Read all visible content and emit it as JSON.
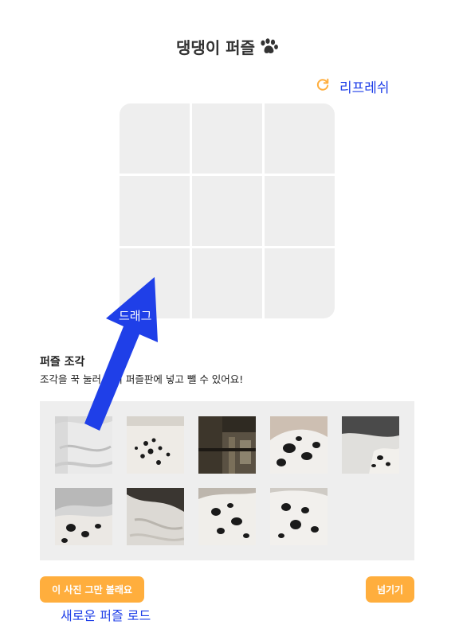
{
  "header": {
    "title": "댕댕이 퍼즐",
    "icon": "paw-icon"
  },
  "refresh": {
    "label": "리프레쉬",
    "icon": "refresh-icon",
    "color": "#ffae3d"
  },
  "board": {
    "rows": 3,
    "cols": 3,
    "cell_color": "#eeeeee"
  },
  "pieces_section": {
    "title": "퍼즐 조각",
    "description": "조각을 꾹 눌러서 위 퍼즐판에 넣고 뺄 수 있어요!",
    "pieces": [
      {
        "name": "puzzle-piece-1"
      },
      {
        "name": "puzzle-piece-2"
      },
      {
        "name": "puzzle-piece-3"
      },
      {
        "name": "puzzle-piece-4"
      },
      {
        "name": "puzzle-piece-5"
      },
      {
        "name": "puzzle-piece-6"
      },
      {
        "name": "puzzle-piece-7"
      },
      {
        "name": "puzzle-piece-8"
      },
      {
        "name": "puzzle-piece-9"
      }
    ]
  },
  "footer": {
    "new_photo_label": "이 사진 그만 볼래요",
    "skip_label": "넘기기",
    "new_caption": "새로운 퍼즐 로드"
  },
  "annotation": {
    "drag_label": "드래그",
    "arrow_color": "#1f3fe8"
  },
  "colors": {
    "accent": "#ffae3d",
    "link": "#1f3fe8",
    "tray": "#eeeeee"
  }
}
